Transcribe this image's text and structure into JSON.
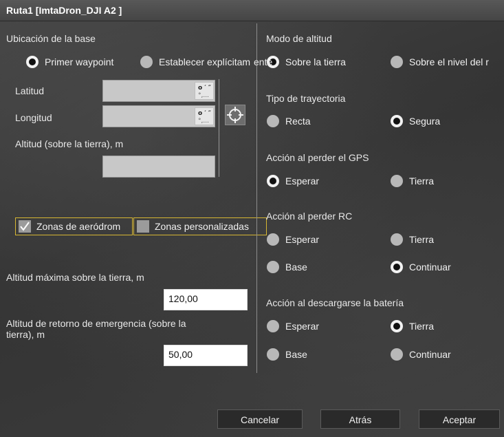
{
  "window": {
    "title": "Ruta1 [ImtaDron_DJI A2 ]"
  },
  "base": {
    "section_label": "Ubicación de la base",
    "option_first_waypoint": "Primer waypoint",
    "option_explicit": "Establecer explícitam",
    "explicit_overflow": "ente",
    "latitude_label": "Latitud",
    "longitude_label": "Longitud",
    "altitude_label": "Altitud (sobre la tierra), m",
    "latitude_value": "",
    "longitude_value": "",
    "altitude_value": "",
    "selected": "Primer waypoint"
  },
  "zones": {
    "aerodrome_label": "Zonas de aeródrom",
    "aerodrome_checked": true,
    "custom_label": "Zonas personalizadas",
    "custom_checked": false
  },
  "limits": {
    "max_altitude_label": "Altitud máxima sobre la tierra, m",
    "max_altitude_value": "120,00",
    "return_altitude_label_line1": "Altitud de retorno de emergencia (sobre la",
    "return_altitude_label_line2": "tierra), m",
    "return_altitude_value": "50,00"
  },
  "altitude_mode": {
    "label": "Modo de altitud",
    "options": [
      "Sobre la tierra",
      "Sobre el nivel del r"
    ],
    "selected": "Sobre la tierra"
  },
  "trajectory": {
    "label": "Tipo de trayectoria",
    "options": [
      "Recta",
      "Segura"
    ],
    "selected": "Segura"
  },
  "gps_loss": {
    "label": "Acción al perder el GPS",
    "options": [
      "Esperar",
      "Tierra"
    ],
    "selected": "Esperar"
  },
  "rc_loss": {
    "label": "Acción al perder RC",
    "options": [
      "Esperar",
      "Tierra",
      "Base",
      "Continuar"
    ],
    "selected": "Continuar"
  },
  "battery": {
    "label": "Acción al descargarse la batería",
    "options": [
      "Esperar",
      "Tierra",
      "Base",
      "Continuar"
    ],
    "selected": "Tierra"
  },
  "buttons": {
    "cancel": "Cancelar",
    "back": "Atrás",
    "accept": "Aceptar"
  },
  "icons": {
    "coordinate_format": "dms-format-icon",
    "pick_location": "crosshair-icon",
    "check": "checkmark-icon"
  }
}
